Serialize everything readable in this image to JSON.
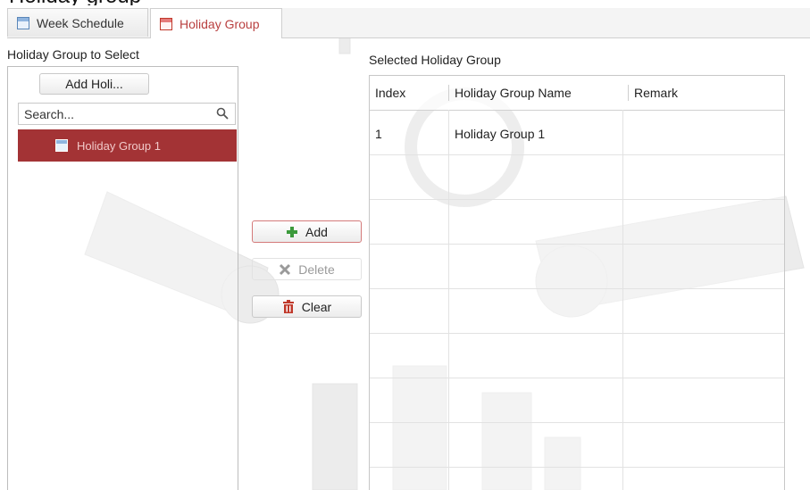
{
  "tabs": [
    {
      "label": "Week Schedule",
      "icon": "calendar-icon"
    },
    {
      "label": "Holiday Group",
      "icon": "holiday-icon",
      "active": true
    }
  ],
  "left_panel": {
    "title": "Holiday Group to Select",
    "add_button": "Add Holi...",
    "search_placeholder": "Search...",
    "items": [
      {
        "label": "Holiday Group 1",
        "selected": true
      }
    ]
  },
  "actions": {
    "add": "Add",
    "delete": "Delete",
    "clear": "Clear"
  },
  "right_panel": {
    "title": "Selected Holiday Group",
    "columns": [
      "Index",
      "Holiday Group Name",
      "Remark"
    ],
    "rows": [
      {
        "index": "1",
        "name": "Holiday Group 1",
        "remark": ""
      }
    ]
  },
  "colors": {
    "accent": "#b94040",
    "selected_bg": "#a33335"
  }
}
